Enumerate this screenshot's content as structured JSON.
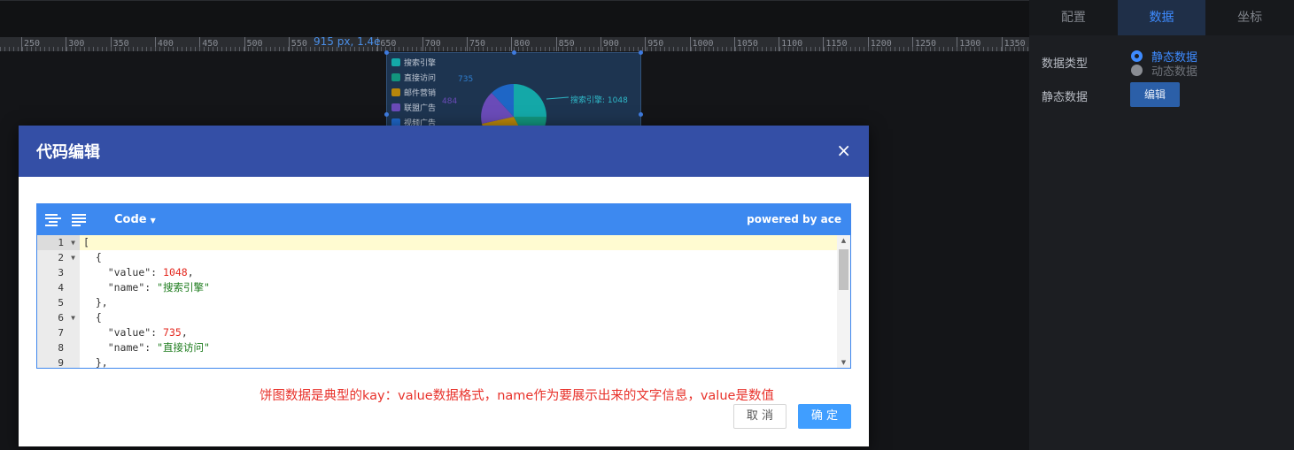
{
  "ruler": {
    "ticks": [
      "250",
      "300",
      "350",
      "400",
      "450",
      "500",
      "550",
      "650",
      "700",
      "750",
      "800",
      "850",
      "900",
      "950",
      "1000",
      "1050",
      "1100",
      "1150",
      "1200",
      "1250",
      "1300",
      "1350"
    ]
  },
  "chart_widget": {
    "title": "915 px, 1.4e",
    "legend": [
      {
        "label": "搜索引擎",
        "color": "#14a8a8"
      },
      {
        "label": "直接访问",
        "color": "#12947d"
      },
      {
        "label": "邮件营销",
        "color": "#b8860b"
      },
      {
        "label": "联盟广告",
        "color": "#6a4bb8"
      },
      {
        "label": "视频广告",
        "color": "#1e66c6"
      }
    ],
    "pie_label": "搜索引擎: 1048",
    "side_labels": [
      "735",
      "484"
    ]
  },
  "right_panel": {
    "tabs": [
      "配置",
      "数据",
      "坐标"
    ],
    "active_tab": 1,
    "data_type_label": "数据类型",
    "radio_static": "静态数据",
    "radio_dynamic": "动态数据",
    "static_data_label": "静态数据",
    "edit_button": "编辑"
  },
  "modal": {
    "title": "代码编辑",
    "close": "×",
    "toolbar": {
      "mode": "Code",
      "powered_by": "powered by ace"
    },
    "line_numbers": [
      "1",
      "2",
      "3",
      "4",
      "5",
      "6",
      "7",
      "8",
      "9"
    ],
    "code_lines": [
      {
        "indent": "",
        "parts": [
          {
            "t": "[",
            "c": "p"
          }
        ]
      },
      {
        "indent": "  ",
        "parts": [
          {
            "t": "{",
            "c": "p"
          }
        ]
      },
      {
        "indent": "    ",
        "parts": [
          {
            "t": "\"value\"",
            "c": "k"
          },
          {
            "t": ": ",
            "c": "p"
          },
          {
            "t": "1048",
            "c": "n"
          },
          {
            "t": ",",
            "c": "p"
          }
        ]
      },
      {
        "indent": "    ",
        "parts": [
          {
            "t": "\"name\"",
            "c": "k"
          },
          {
            "t": ": ",
            "c": "p"
          },
          {
            "t": "\"搜索引擎\"",
            "c": "s"
          }
        ]
      },
      {
        "indent": "  ",
        "parts": [
          {
            "t": "},",
            "c": "p"
          }
        ]
      },
      {
        "indent": "  ",
        "parts": [
          {
            "t": "{",
            "c": "p"
          }
        ]
      },
      {
        "indent": "    ",
        "parts": [
          {
            "t": "\"value\"",
            "c": "k"
          },
          {
            "t": ": ",
            "c": "p"
          },
          {
            "t": "735",
            "c": "n"
          },
          {
            "t": ",",
            "c": "p"
          }
        ]
      },
      {
        "indent": "    ",
        "parts": [
          {
            "t": "\"name\"",
            "c": "k"
          },
          {
            "t": ": ",
            "c": "p"
          },
          {
            "t": "\"直接访问\"",
            "c": "s"
          }
        ]
      },
      {
        "indent": "  ",
        "parts": [
          {
            "t": "},",
            "c": "p"
          }
        ]
      }
    ],
    "annotation": "饼图数据是典型的kay：value数据格式，name作为要展示出来的文字信息，value是数值",
    "cancel": "取 消",
    "ok": "确 定"
  },
  "colors": {
    "header": "#344fa6",
    "toolbar": "#3d89f0",
    "primary_button": "#409eff",
    "annotation": "#e8322b"
  }
}
